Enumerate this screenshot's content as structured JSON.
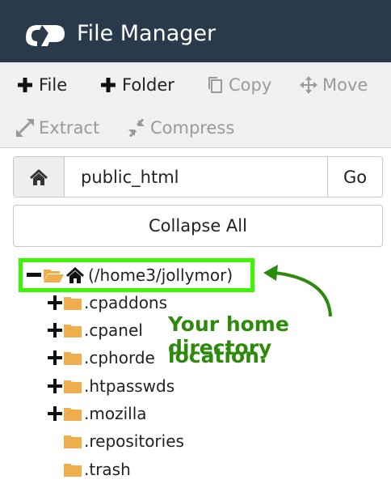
{
  "header": {
    "title": "File Manager",
    "bg_color": "#293a4a"
  },
  "toolbar": {
    "file_label": "File",
    "folder_label": "Folder",
    "copy_label": "Copy",
    "move_label": "Move",
    "extract_label": "Extract",
    "compress_label": "Compress"
  },
  "pathbar": {
    "value": "public_html",
    "go_label": "Go"
  },
  "collapse_label": "Collapse All",
  "tree": {
    "root_label": "(/home3/jollymor)",
    "items": [
      {
        "label": ".cpaddons",
        "expandable": true
      },
      {
        "label": ".cpanel",
        "expandable": true
      },
      {
        "label": ".cphorde",
        "expandable": true
      },
      {
        "label": ".htpasswds",
        "expandable": true
      },
      {
        "label": ".mozilla",
        "expandable": true
      },
      {
        "label": ".repositories",
        "expandable": false
      },
      {
        "label": ".trash",
        "expandable": false
      }
    ]
  },
  "annotation": {
    "line1": "Your home directory",
    "line2": "location.",
    "color": "#2e8a0c",
    "highlight_color": "#3cf500"
  },
  "colors": {
    "folder": "#f0ad4e"
  }
}
